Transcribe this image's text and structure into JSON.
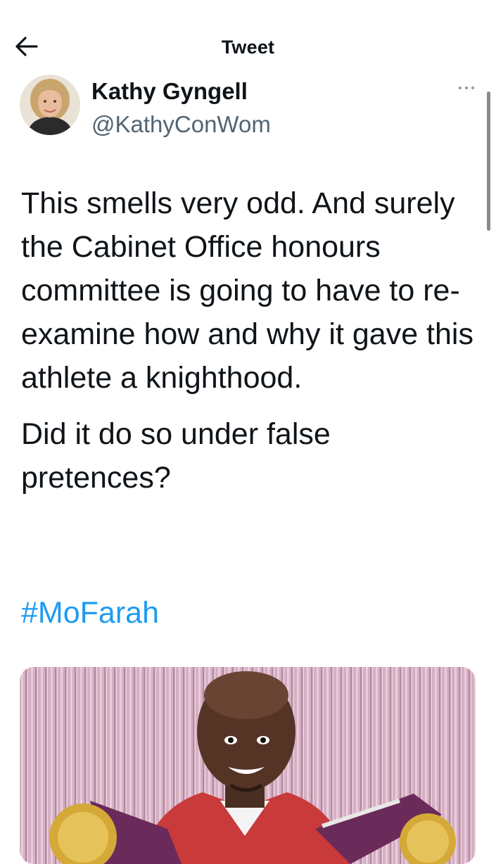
{
  "header": {
    "title": "Tweet",
    "back_icon": "back-arrow-icon"
  },
  "author": {
    "name": "Kathy Gyngell",
    "handle": "@KathyConWom",
    "avatar_icon": "profile-photo",
    "more_icon": "more-options-icon"
  },
  "tweet": {
    "paragraphs": [
      "This smells very odd. And surely the Cabinet Office honours committee is going to have to re-examine how and why it gave this athlete a knighthood.",
      "Did it do so under false pretences?"
    ],
    "hashtag": "#MoFarah"
  },
  "media": {
    "type": "photo"
  },
  "colors": {
    "link": "#1d9bf0",
    "secondary_text": "#536471",
    "text": "#0f1419"
  }
}
